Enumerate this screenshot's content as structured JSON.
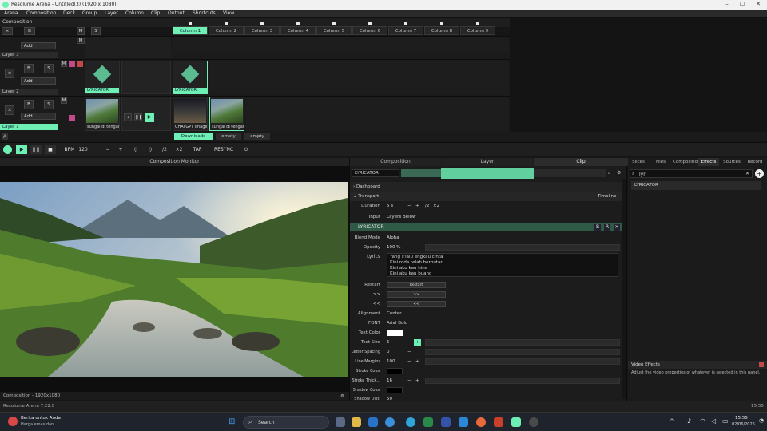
{
  "title_bar": {
    "title": "Resolume Arena - Untitled(3) (1920 x 1080)"
  },
  "menu": [
    "Arena",
    "Composition",
    "Deck",
    "Group",
    "Layer",
    "Column",
    "Clip",
    "Output",
    "Shortcuts",
    "View"
  ],
  "composition_label": "Composition",
  "columns": [
    "Column 1",
    "Column 2",
    "Column 3",
    "Column 4",
    "Column 5",
    "Column 6",
    "Column 7",
    "Column 8",
    "Column 9"
  ],
  "layers": [
    {
      "name": "Layer 3"
    },
    {
      "name": "Layer 2",
      "clips": [
        {
          "label": "LYRICATOR"
        },
        {
          "label": "LYRICATOR"
        }
      ]
    },
    {
      "name": "Layer 1",
      "clips": [
        {
          "label": "sungai di tengah g..."
        },
        {
          "label": "CHATGPT image &..."
        },
        {
          "label": "sungai di tengah..."
        }
      ]
    }
  ],
  "add_label": "Add",
  "layer_buttons": {
    "x": "×",
    "b": "B",
    "s": "S",
    "m": "M",
    "a": "A"
  },
  "deck_tabs": [
    "Downloads",
    "empty",
    "empty"
  ],
  "transport": {
    "bpm_label": "BPM",
    "bpm": "120",
    "minus": "−",
    "plus": "+",
    "half": "/2",
    "double": "×2",
    "tap": "TAP",
    "resync": "RESYNC"
  },
  "monitor": {
    "header": "Composition Monitor",
    "footer": "Composition - 1920x1080"
  },
  "clip_panel": {
    "tabs": [
      "Composition",
      "Layer",
      "Clip"
    ],
    "clip_name": "LYRICATOR",
    "dashboard": "Dashboard",
    "transport": "Transport",
    "timeline": "Timeline",
    "duration_label": "Duration",
    "duration_value": "5 s",
    "input_label": "Input",
    "input_value": "Layers Below",
    "effect_title": "LYRICATOR",
    "blend_mode_label": "Blend Mode",
    "blend_mode_value": "Alpha",
    "opacity_label": "Opacity",
    "opacity_value": "100 %",
    "lyrics_label": "Lyrics",
    "lyrics_lines": [
      "Yang s'lalu engkau cinta",
      "Kini roda telah berputar",
      "Kini aku kau hina",
      "Kini aku kau buang"
    ],
    "restart_label": "Restart",
    "restart_btn": "Restart",
    "next_label": ">>",
    "prev_label": "<<",
    "alignment_label": "Alignment",
    "alignment_value": "Center",
    "font_label": "FONT",
    "font_value": "Arial Bold",
    "text_color_label": "Text Color",
    "text_size_label": "Text Size",
    "text_size_value": "5",
    "letter_spacing_label": "Letter Spacing",
    "letter_spacing_value": "0",
    "line_margins_label": "Line Margins",
    "line_margins_value": "100",
    "stroke_color_label": "Stroke Color",
    "stroke_thick_label": "Stroke Thick...",
    "stroke_thick_value": "16",
    "shadow_color_label": "Shadow Color",
    "shadow_dist_label": "Shadow Dist.",
    "shadow_dist_value": "50"
  },
  "right_panel": {
    "tabs": [
      "Slices",
      "Files",
      "Composition",
      "Effects",
      "Sources",
      "Record"
    ],
    "search_value": "lyri",
    "result": "LYRICATOR",
    "video_effects_title": "Video Effects",
    "video_effects_desc": "Adjust the video properties of whatever is selected in this panel."
  },
  "status": {
    "version": "Resolume Arena 7.22.0",
    "time": "15:55"
  },
  "taskbar": {
    "news_title": "Berita untuk Anda",
    "news_sub": "Harga emas dan...",
    "search": "Search",
    "clock_time": "15:55",
    "clock_date": "02/06/2026"
  },
  "colors": {
    "accent": "#6ef0b5",
    "effect_header": "#2f5a46"
  }
}
